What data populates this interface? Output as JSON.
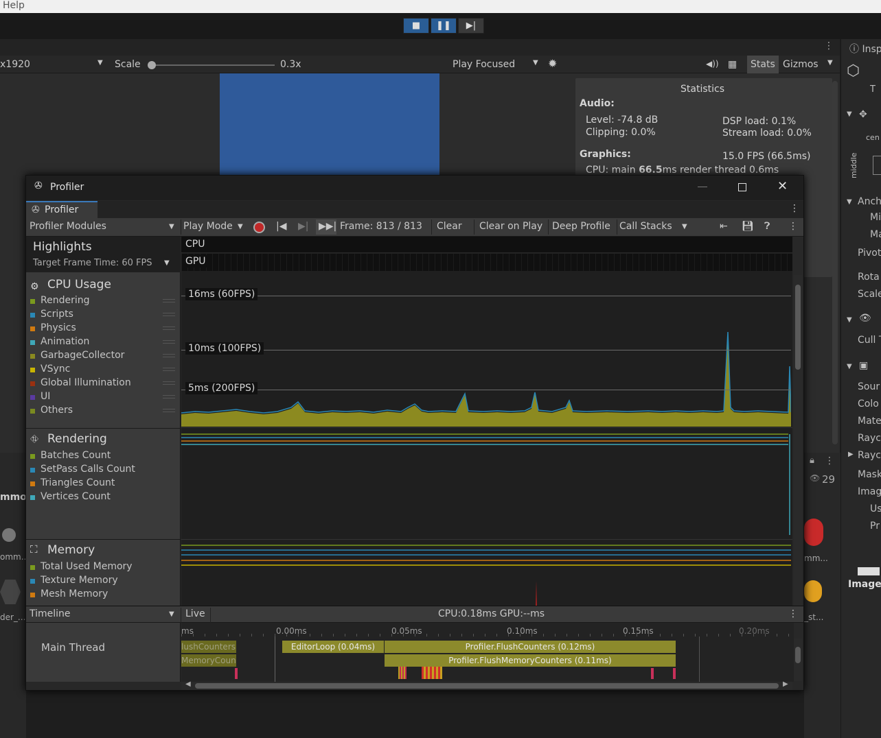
{
  "menu": {
    "help": "Help"
  },
  "playbar": {
    "stop": "■",
    "pause": "❚❚",
    "step": "▶|"
  },
  "game_toolbar": {
    "resolution": "x1920",
    "scale_label": "Scale",
    "scale_value": "0.3x",
    "play_focused": "Play Focused",
    "stats": "Stats",
    "gizmos": "Gizmos"
  },
  "statistics": {
    "title": "Statistics",
    "audio": "Audio:",
    "level": "Level: -74.8 dB",
    "clipping": "Clipping: 0.0%",
    "dsp": "DSP load: 0.1%",
    "stream": "Stream load: 0.0%",
    "graphics": "Graphics:",
    "fps": "15.0 FPS (66.5ms)",
    "cpu_prefix": "CPU: main ",
    "cpu_main": "66.5",
    "cpu_suffix": "ms  render thread 0.6ms"
  },
  "inspector": {
    "title": "Insp",
    "t": "T",
    "cen": "cen",
    "middle": "middle",
    "anch": "Anch",
    "mi": "Mi",
    "ma": "Ma",
    "pivot": "Pivot",
    "rota": "Rota",
    "scale": "Scale",
    "cull": "Cull T",
    "sour": "Sour",
    "colo": "Colo",
    "mate": "Mate",
    "rayc1": "Rayc",
    "rayc2": "Rayc",
    "mask": "Mask",
    "imag": "Imag",
    "us": "Us",
    "pr": "Pr",
    "image": "Image",
    "count": "29"
  },
  "side": {
    "mmon": "mmon",
    "omm": "omm...",
    "der": "der_...",
    "mm2": "mm...",
    "st": "_st..."
  },
  "profiler": {
    "window_title": "Profiler",
    "tab": "Profiler",
    "modules": "Profiler Modules",
    "play_mode": "Play Mode",
    "frame": "Frame: 813 / 813",
    "clear": "Clear",
    "clear_on_play": "Clear on Play",
    "deep_profile": "Deep Profile",
    "call_stacks": "Call Stacks",
    "highlights": "Highlights",
    "target_frame": "Target Frame Time: 60 FPS",
    "cpu_lane": "CPU",
    "gpu_lane": "GPU",
    "cpu_usage": {
      "title": "CPU Usage",
      "items": [
        {
          "label": "Rendering",
          "color": "#7a9a1e"
        },
        {
          "label": "Scripts",
          "color": "#2a88b5"
        },
        {
          "label": "Physics",
          "color": "#d07a10"
        },
        {
          "label": "Animation",
          "color": "#3fa8b8"
        },
        {
          "label": "GarbageCollector",
          "color": "#8a8a20"
        },
        {
          "label": "VSync",
          "color": "#c8b400"
        },
        {
          "label": "Global Illumination",
          "color": "#9a3010"
        },
        {
          "label": "UI",
          "color": "#5a3aa0"
        },
        {
          "label": "Others",
          "color": "#7a8a20"
        }
      ],
      "thresholds": [
        "16ms (60FPS)",
        "10ms (100FPS)",
        "5ms (200FPS)"
      ]
    },
    "rendering": {
      "title": "Rendering",
      "items": [
        {
          "label": "Batches Count",
          "color": "#7a9a1e"
        },
        {
          "label": "SetPass Calls Count",
          "color": "#2a88b5"
        },
        {
          "label": "Triangles Count",
          "color": "#d07a10"
        },
        {
          "label": "Vertices Count",
          "color": "#3fa8b8"
        }
      ]
    },
    "memory": {
      "title": "Memory",
      "items": [
        {
          "label": "Total Used Memory",
          "color": "#7a9a1e"
        },
        {
          "label": "Texture Memory",
          "color": "#2a88b5"
        },
        {
          "label": "Mesh Memory",
          "color": "#d07a10"
        }
      ]
    },
    "timeline": {
      "mode": "Timeline",
      "live": "Live",
      "cpu_gpu": "CPU:0.18ms   GPU:--ms",
      "thread": "Main Thread",
      "ticks": [
        "ms",
        "0.00ms",
        "0.05ms",
        "0.10ms",
        "0.15ms",
        "0.20ms"
      ],
      "bars": [
        {
          "label": "lushCounters"
        },
        {
          "label": "MemoryCoun"
        },
        {
          "label": "EditorLoop (0.04ms)"
        },
        {
          "label": "Profiler.FlushCounters (0.12ms)"
        },
        {
          "label": "Profiler.FlushMemoryCounters (0.11ms)"
        }
      ]
    }
  }
}
